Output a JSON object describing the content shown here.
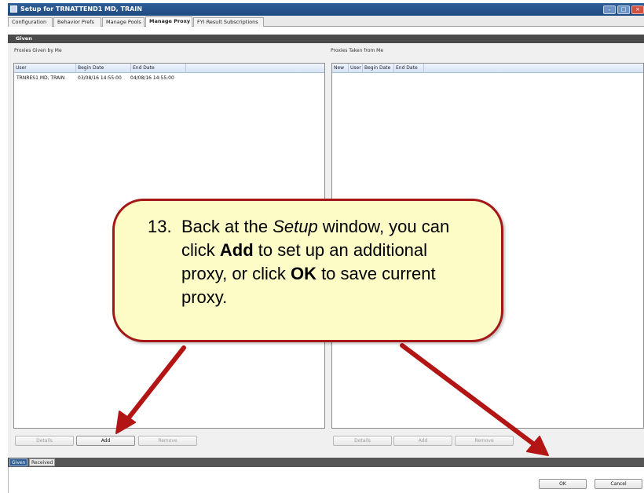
{
  "window": {
    "title": "Setup for TRNATTEND1 MD, TRAIN",
    "minimize_glyph": "–",
    "maximize_glyph": "□",
    "close_glyph": "×"
  },
  "tabs": [
    {
      "label": "Configuration"
    },
    {
      "label": "Behavior Prefs"
    },
    {
      "label": "Manage Pools"
    },
    {
      "label": "Manage Proxy"
    },
    {
      "label": "FYI Result Subscriptions"
    }
  ],
  "section_header": "Given",
  "given_panel": {
    "title": "Proxies Given by Me",
    "columns": [
      "User",
      "Begin Date",
      "End Date"
    ],
    "rows": [
      {
        "user": "TRNRES1 MD, TRAIN",
        "begin": "03/08/16 14:55:00",
        "end": "04/08/16 14:55:00"
      }
    ],
    "buttons": {
      "details": "Details",
      "add": "Add",
      "remove": "Remove"
    }
  },
  "taken_panel": {
    "title": "Proxies Taken from Me",
    "columns": [
      "New",
      "User",
      "Begin Date",
      "End Date"
    ],
    "buttons": {
      "details": "Details",
      "add": "Add",
      "remove": "Remove"
    }
  },
  "bottom_tabs": [
    {
      "label": "Given"
    },
    {
      "label": "Received"
    }
  ],
  "footer_buttons": {
    "ok": "OK",
    "cancel": "Cancel"
  },
  "callout": {
    "number": "13.",
    "text_1": "Back at the ",
    "text_2_italic": "Setup",
    "text_3": " window, you can click ",
    "text_4_bold": "Add",
    "text_5": " to set up an additional proxy, or click ",
    "text_6_bold": "OK",
    "text_7": " to save current proxy."
  },
  "colors": {
    "callout_fill": "#fdfbc6",
    "callout_border": "#a51717",
    "arrow": "#b31515",
    "titlebar": "#2f5f98"
  }
}
